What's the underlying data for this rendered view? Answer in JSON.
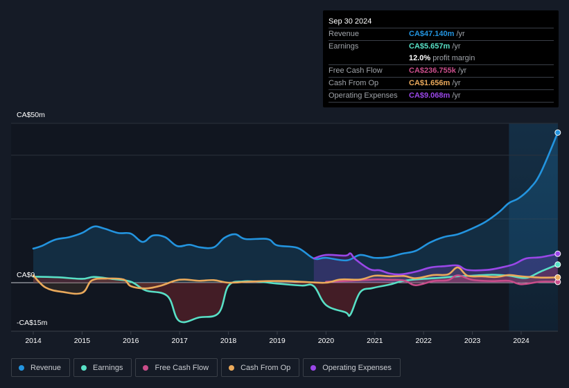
{
  "tooltip": {
    "date": "Sep 30 2024",
    "rows": [
      {
        "label": "Revenue",
        "value": "CA$47.140m",
        "unit": "/yr",
        "color": "#2394df"
      },
      {
        "label": "Earnings",
        "value": "CA$5.657m",
        "unit": "/yr",
        "color": "#58e0c6"
      },
      {
        "label": "",
        "value": "12.0%",
        "unit": "profit margin",
        "color": "#ffffff"
      },
      {
        "label": "Free Cash Flow",
        "value": "CA$236.755k",
        "unit": "/yr",
        "color": "#c94d8a"
      },
      {
        "label": "Cash From Op",
        "value": "CA$1.656m",
        "unit": "/yr",
        "color": "#eaa95b"
      },
      {
        "label": "Operating Expenses",
        "value": "CA$9.068m",
        "unit": "/yr",
        "color": "#9a47e8"
      }
    ]
  },
  "legend": [
    {
      "label": "Revenue",
      "color": "#2394df"
    },
    {
      "label": "Earnings",
      "color": "#58e0c6"
    },
    {
      "label": "Free Cash Flow",
      "color": "#c94d8a"
    },
    {
      "label": "Cash From Op",
      "color": "#eaa95b"
    },
    {
      "label": "Operating Expenses",
      "color": "#9a47e8"
    }
  ],
  "chart_data": {
    "type": "line",
    "title": "",
    "xlabel": "",
    "ylabel": "",
    "y_tick_labels": [
      "CA$50m",
      "CA$0",
      "-CA$15m"
    ],
    "ylim": [
      -15,
      50
    ],
    "xlim": [
      2013.5,
      2024.9
    ],
    "x_ticks": [
      2014,
      2015,
      2016,
      2017,
      2018,
      2019,
      2020,
      2021,
      2022,
      2023,
      2024
    ],
    "gridlines_m": [
      50,
      40,
      20,
      0
    ],
    "grid": true,
    "highlight_from": 2023.75,
    "legend_position": "bottom",
    "units": "CA$ millions per year",
    "series": [
      {
        "name": "Revenue",
        "color": "#2394df",
        "x": [
          2014.0,
          2014.17,
          2014.45,
          2014.74,
          2015.0,
          2015.24,
          2015.45,
          2015.74,
          2016.0,
          2016.24,
          2016.45,
          2016.7,
          2016.95,
          2017.2,
          2017.42,
          2017.7,
          2017.92,
          2018.14,
          2018.35,
          2018.8,
          2019.0,
          2019.42,
          2019.75,
          2020.0,
          2020.42,
          2020.7,
          2020.99,
          2021.27,
          2021.56,
          2021.84,
          2022.13,
          2022.41,
          2022.7,
          2022.98,
          2023.27,
          2023.55,
          2023.75,
          2023.95,
          2024.18,
          2024.4,
          2024.75
        ],
        "values": [
          10.7,
          11.5,
          13.5,
          14.3,
          15.6,
          17.6,
          17.0,
          15.6,
          15.4,
          12.8,
          14.8,
          14.3,
          11.5,
          11.9,
          11.1,
          11.1,
          14.1,
          15.2,
          13.7,
          13.7,
          11.7,
          10.9,
          7.6,
          7.8,
          7.0,
          8.7,
          7.8,
          8.0,
          9.1,
          10.0,
          12.6,
          14.3,
          15.2,
          16.9,
          19.1,
          22.2,
          25.0,
          26.5,
          29.6,
          34.5,
          47.1
        ]
      },
      {
        "name": "Earnings",
        "color": "#58e0c6",
        "x": [
          2014.0,
          2014.5,
          2015.0,
          2015.24,
          2015.6,
          2016.0,
          2016.3,
          2016.75,
          2016.99,
          2017.4,
          2017.8,
          2018.0,
          2018.3,
          2018.7,
          2019.0,
          2019.5,
          2019.75,
          2020.0,
          2020.4,
          2020.5,
          2020.7,
          2020.95,
          2021.3,
          2021.6,
          2022.0,
          2022.4,
          2022.7,
          2023.0,
          2023.4,
          2023.75,
          2024.1,
          2024.4,
          2024.75
        ],
        "values": [
          1.9,
          1.7,
          1.2,
          1.8,
          1.2,
          0.3,
          -2.4,
          -4.2,
          -12.0,
          -10.9,
          -9.5,
          -1.0,
          0.4,
          0.2,
          -0.3,
          -0.9,
          -1.1,
          -7.0,
          -9.3,
          -10.0,
          -3.0,
          -1.7,
          -0.6,
          0.6,
          1.2,
          1.6,
          2.0,
          2.2,
          2.5,
          2.2,
          1.5,
          3.5,
          5.7
        ]
      },
      {
        "name": "Free Cash Flow",
        "color": "#c94d8a",
        "x": [
          2020.0,
          2020.5,
          2021.0,
          2021.3,
          2021.6,
          2021.84,
          2022.2,
          2022.5,
          2022.7,
          2023.0,
          2023.4,
          2023.75,
          2024.0,
          2024.4,
          2024.75
        ],
        "values": [
          0.3,
          0.6,
          1.0,
          0.9,
          0.7,
          -0.8,
          0.5,
          0.8,
          2.3,
          0.9,
          0.5,
          0.6,
          -0.5,
          0.3,
          0.24
        ]
      },
      {
        "name": "Cash From Op",
        "color": "#eaa95b",
        "x": [
          2014.0,
          2014.25,
          2014.6,
          2015.0,
          2015.2,
          2015.5,
          2015.85,
          2016.0,
          2016.3,
          2016.6,
          2016.9,
          2017.1,
          2017.4,
          2017.7,
          2018.0,
          2018.4,
          2018.8,
          2019.2,
          2019.6,
          2020.0,
          2020.3,
          2020.7,
          2021.0,
          2021.3,
          2021.6,
          2021.84,
          2022.2,
          2022.5,
          2022.7,
          2022.9,
          2023.2,
          2023.5,
          2023.75,
          2024.0,
          2024.4,
          2024.75
        ],
        "values": [
          2.3,
          -1.5,
          -2.9,
          -3.2,
          0.7,
          1.3,
          1.0,
          -1.1,
          -1.8,
          -1.0,
          0.6,
          1.0,
          0.6,
          0.8,
          0.0,
          0.3,
          0.5,
          0.5,
          0.2,
          0.0,
          1.0,
          1.0,
          2.2,
          2.0,
          2.1,
          1.4,
          2.4,
          2.6,
          4.8,
          2.2,
          2.0,
          1.8,
          2.4,
          2.0,
          1.6,
          1.66
        ]
      },
      {
        "name": "Operating Expenses",
        "color": "#9a47e8",
        "x": [
          2019.75,
          2020.0,
          2020.4,
          2020.5,
          2020.6,
          2020.9,
          2021.1,
          2021.3,
          2021.5,
          2021.7,
          2021.9,
          2022.15,
          2022.45,
          2022.7,
          2022.9,
          2023.3,
          2023.6,
          2023.85,
          2024.1,
          2024.4,
          2024.75
        ],
        "values": [
          7.6,
          8.7,
          8.5,
          9.2,
          7.4,
          4.2,
          3.9,
          2.9,
          2.6,
          3.0,
          3.7,
          4.8,
          5.2,
          5.4,
          4.0,
          4.0,
          4.8,
          5.8,
          7.6,
          8.0,
          9.07
        ]
      }
    ]
  }
}
